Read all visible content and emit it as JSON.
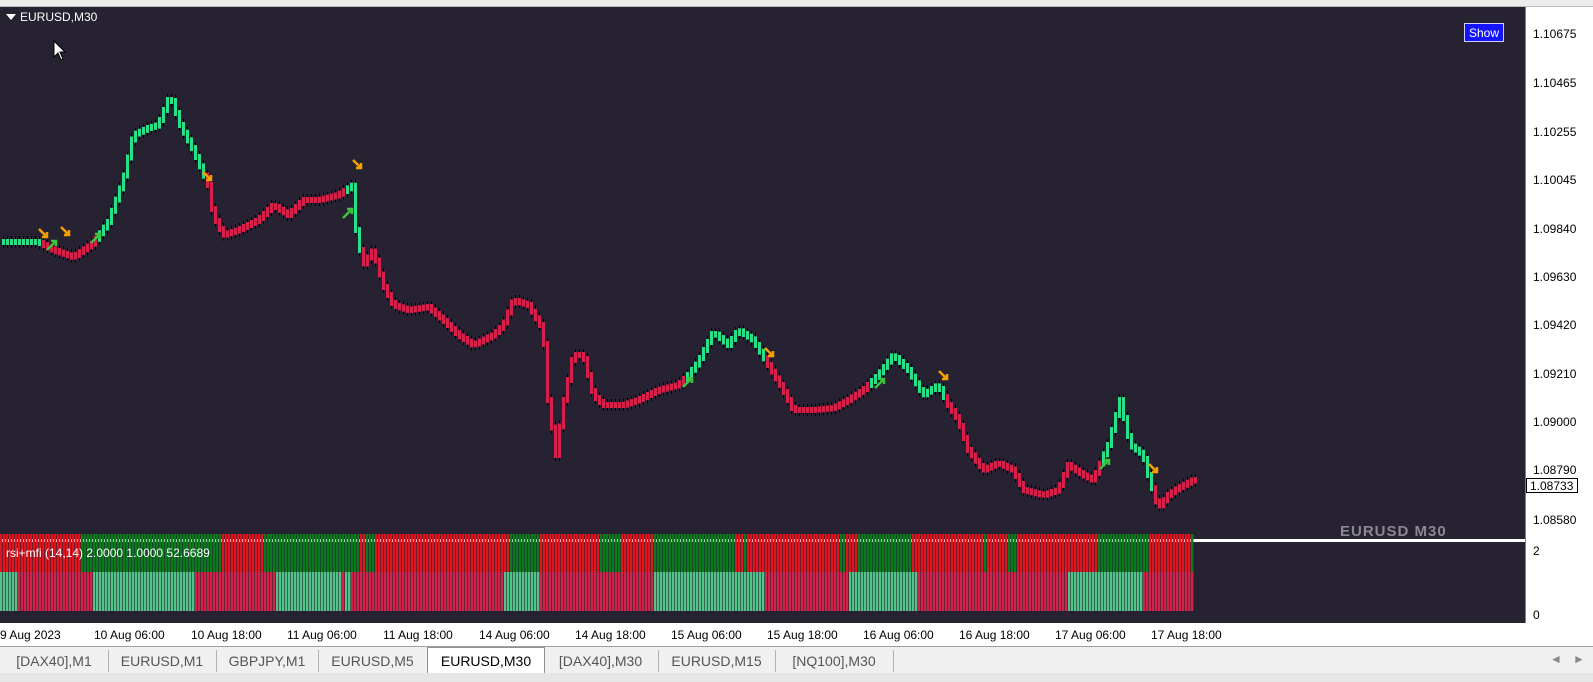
{
  "chart": {
    "title": "EURUSD,M30",
    "show_button": "Show",
    "watermark": "EURUSD M30",
    "current_price": "1.08733",
    "price_labels": [
      "1.10675",
      "1.10465",
      "1.10255",
      "1.10045",
      "1.09840",
      "1.09630",
      "1.09420",
      "1.09210",
      "1.09000",
      "1.08790",
      "1.08580"
    ],
    "time_labels": [
      "9 Aug 2023",
      "10 Aug 06:00",
      "10 Aug 18:00",
      "11 Aug 06:00",
      "11 Aug 18:00",
      "14 Aug 06:00",
      "14 Aug 18:00",
      "15 Aug 06:00",
      "15 Aug 18:00",
      "16 Aug 06:00",
      "16 Aug 18:00",
      "17 Aug 06:00",
      "17 Aug 18:00"
    ],
    "colors": {
      "background": "#262231",
      "bull": "#28e08a",
      "bear": "#d81e4a",
      "buy_arrow": "#3cc43c",
      "sell_arrow": "#f5a000"
    }
  },
  "indicator": {
    "label": "rsi+mfi (14,14) 2.0000 1.0000 52.6689",
    "levels": [
      "2",
      "0"
    ],
    "colors": {
      "top_bull": "#0a7a1e",
      "top_bear": "#e0141e",
      "bottom_bull": "#52c48a",
      "bottom_bear": "#d2244a"
    }
  },
  "tabs": [
    {
      "label": "[DAX40],M1",
      "active": false
    },
    {
      "label": "EURUSD,M1",
      "active": false
    },
    {
      "label": "GBPJPY,M1",
      "active": false
    },
    {
      "label": "EURUSD,M5",
      "active": false
    },
    {
      "label": "EURUSD,M30",
      "active": true
    },
    {
      "label": "[DAX40],M30",
      "active": false
    },
    {
      "label": "EURUSD,M15",
      "active": false
    },
    {
      "label": "[NQ100],M30",
      "active": false
    }
  ],
  "nav": {
    "left": "◄",
    "right": "►"
  }
}
